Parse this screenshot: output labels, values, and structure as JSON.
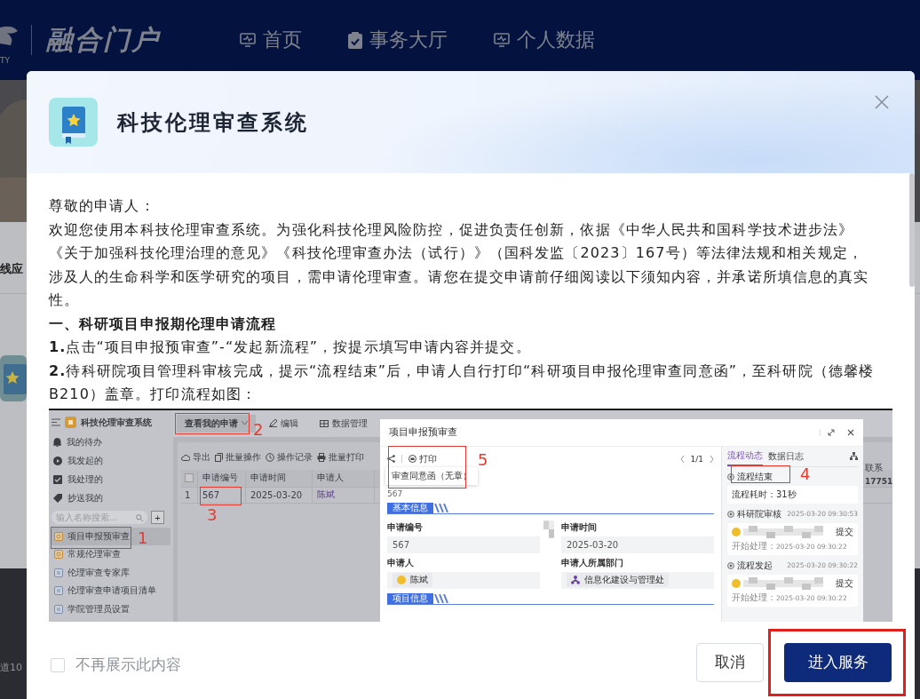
{
  "portal": {
    "emblem_text": "TY",
    "title": "融合门户",
    "nav": [
      {
        "label": "首页"
      },
      {
        "label": "事务大厅"
      },
      {
        "label": "个人数据"
      }
    ],
    "side_texts": [
      "线应",
      "道10"
    ]
  },
  "dialog": {
    "title": "科技伦理审查系统",
    "paragraphs": [
      {
        "kind": "text",
        "text": "尊敬的申请人："
      },
      {
        "kind": "text",
        "text": "欢迎您使用本科技伦理审查系统。为强化科技伦理风险防控，促进负责任创新，依据《中华人民共和国科学技术进步法》《关于加强科技伦理治理的意见》《科技伦理审查办法（试行）》（国科发监〔2023〕167号）等法律法规和相关规定，涉及人的生命科学和医学研究的项目，需申请伦理审查。请您在提交申请前仔细阅读以下须知内容，并承诺所填信息的真实性。"
      },
      {
        "kind": "heading",
        "text": "一、科研项目申报期伦理申请流程"
      },
      {
        "kind": "text",
        "text": "**1.**点击“项目申报预审查”-“发起新流程”，按提示填写申请内容并提交。"
      },
      {
        "kind": "text",
        "text": "**2.**待科研院项目管理科审核完成，提示“流程结束”后，申请人自行打印“科研项目申报伦理审查同意函”，至科研院（德馨楼B210）盖章。打印流程如图："
      }
    ],
    "figure": {
      "app_title": "科技伦理审查系统",
      "menu": [
        {
          "label": "我的待办"
        },
        {
          "label": "我发起的"
        },
        {
          "label": "我处理的"
        },
        {
          "label": "抄送我的"
        }
      ],
      "search": {
        "placeholder": "输入名称搜索..."
      },
      "add_label": "+",
      "forms": [
        {
          "label": "项目申报预审查",
          "kind": "flow",
          "selected": true
        },
        {
          "label": "常规伦理审查",
          "kind": "flow",
          "selected": false
        },
        {
          "label": "伦理审查专家库",
          "kind": "sheet",
          "selected": false
        },
        {
          "label": "伦理审查申请项目清单",
          "kind": "sheet",
          "selected": false
        },
        {
          "label": "学院管理员设置",
          "kind": "sheet",
          "selected": false
        }
      ],
      "tabs": [
        {
          "label": "查看我的申请",
          "selected": true
        },
        {
          "label": "编辑",
          "selected": false
        },
        {
          "label": "数据管理",
          "selected": false
        }
      ],
      "actions": [
        "导出",
        "批量操作",
        "操作记录",
        "批量打印"
      ],
      "table": {
        "all_checked": false,
        "columns": [
          "申请编号",
          "申请时间",
          "申请人"
        ],
        "rows": [
          {
            "index": "1",
            "number": "567",
            "time": "2025-03-20",
            "applicant": "陈斌"
          }
        ]
      },
      "peek": [
        "联系",
        "17751"
      ],
      "record": {
        "title": "项目申报预审查",
        "print": "打印",
        "pager": "1/1",
        "print_option": "审查同意函（无章）",
        "number": "567",
        "sections": [
          {
            "title": "基本信息",
            "fields": [
              {
                "label": "申请编号",
                "value": "567",
                "kind": "text"
              },
              {
                "label": "申请时间",
                "value": "2025-03-20",
                "kind": "text"
              },
              {
                "label": "申请人",
                "value": "陈斌",
                "kind": "person"
              },
              {
                "label": "申请人所属部门",
                "value": "信息化建设与管理处",
                "kind": "dept"
              }
            ]
          },
          {
            "title": "项目信息"
          }
        ],
        "panel_tabs": [
          {
            "label": "流程动态",
            "selected": true
          },
          {
            "label": "数据日志",
            "selected": false
          }
        ],
        "timeline": [
          {
            "kind": "summary",
            "title": "流程结束",
            "note": "流程耗时：31秒"
          },
          {
            "kind": "step",
            "title": "科研院审核",
            "time": "2025-03-20 09:30:53",
            "action": "提交",
            "start_label": "开始处理：",
            "start_time": "2025-03-20 09:30:22"
          },
          {
            "kind": "step",
            "title": "流程发起",
            "time": "2025-03-20 09:30:22",
            "action": "提交",
            "start_label": "开始处理：",
            "start_time": "2025-03-20 09:30:22"
          }
        ]
      },
      "annotations": [
        "1",
        "2",
        "3",
        "4",
        "5"
      ]
    },
    "dont_show": {
      "label": "不再展示此内容",
      "checked": false
    },
    "buttons": [
      {
        "label": "取消",
        "kind": "secondary",
        "highlighted": false
      },
      {
        "label": "进入服务",
        "kind": "primary",
        "highlighted": true
      }
    ]
  }
}
